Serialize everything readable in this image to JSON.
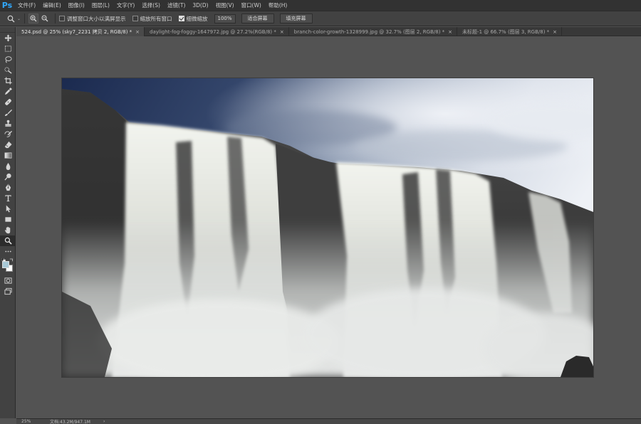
{
  "app": {
    "logo": "Ps",
    "menu": [
      "文件(F)",
      "编辑(E)",
      "图像(I)",
      "图层(L)",
      "文字(Y)",
      "选择(S)",
      "滤镜(T)",
      "3D(D)",
      "视图(V)",
      "窗口(W)",
      "帮助(H)"
    ]
  },
  "options": {
    "tool_icon": "zoom-icon",
    "resize_windows_label": "调整窗口大小以满屏显示",
    "resize_windows_checked": false,
    "zoom_all_label": "缩放所有窗口",
    "zoom_all_checked": false,
    "scrubby_zoom_label": "细微缩放",
    "scrubby_zoom_checked": true,
    "zoom_value": "100%",
    "fit_screen_label": "适合屏幕",
    "fill_screen_label": "填充屏幕"
  },
  "tabs": [
    {
      "title": "524.psd @ 25% (sky7_2231 拷贝 2, RGB/8) *",
      "active": true
    },
    {
      "title": "daylight-fog-foggy-1647972.jpg @ 27.2%(RGB/8) *",
      "active": false
    },
    {
      "title": "branch-color-growth-1328999.jpg @ 32.7% (图层 2, RGB/8) *",
      "active": false
    },
    {
      "title": "未标题-1 @ 66.7% (图层 3, RGB/8) *",
      "active": false
    }
  ],
  "tab_close_glyph": "×",
  "tools": [
    "move-tool",
    "marquee-tool",
    "lasso-tool",
    "quick-selection-tool",
    "crop-tool",
    "eyedropper-tool",
    "healing-brush-tool",
    "brush-tool",
    "clone-stamp-tool",
    "history-brush-tool",
    "eraser-tool",
    "gradient-tool",
    "blur-tool",
    "dodge-tool",
    "pen-tool",
    "type-tool",
    "path-selection-tool",
    "rectangle-tool",
    "hand-tool",
    "zoom-tool",
    "more-tools"
  ],
  "colors": {
    "foreground": "#a8c8d6",
    "background": "#ffffff",
    "accent": "#31a8ff"
  },
  "status": {
    "zoom": "25%",
    "doc_info": "文档:43.2M/947.1M",
    "arrow": "›"
  }
}
